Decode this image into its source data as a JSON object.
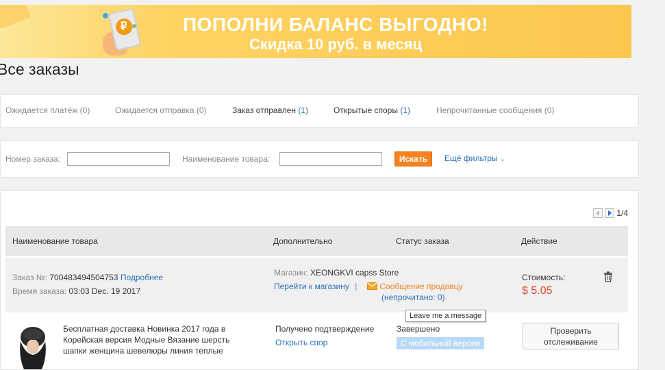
{
  "banner": {
    "line1": "ПОПОЛНИ БАЛАНС ВЫГОДНО!",
    "line2": "Скидка 10 руб. в месяц",
    "coin_symbol": "₽"
  },
  "page_title": "Все заказы",
  "tabs": [
    {
      "label": "Ожидается платёж",
      "count": "(0)"
    },
    {
      "label": "Ожидается отправка",
      "count": "(0)"
    },
    {
      "label": "Заказ отправлен",
      "count": "(1)"
    },
    {
      "label": "Открытые споры",
      "count": "(1)"
    },
    {
      "label": "Непрочитанные сообщения",
      "count": "(0)"
    }
  ],
  "filters": {
    "order_number_label": "Номер заказа:",
    "order_number_value": "",
    "product_name_label": "Наименование товара:",
    "product_name_value": "",
    "search_button": "Искать",
    "more_filters": "Ещё фильтры"
  },
  "pager": {
    "label": "1/4"
  },
  "table": {
    "headers": [
      "Наименование товара",
      "Дополнительно",
      "Статус заказа",
      "Действие"
    ]
  },
  "order": {
    "number_label": "Заказ №:",
    "number_value": "700483494504753",
    "details_link": "Подробнее",
    "time_label": "Время заказа:",
    "time_value": "03:03 Dec. 19 2017",
    "store_label": "Магазин:",
    "store_name": "XEONGKVI capss Store",
    "goto_store": "Перейти к магазину",
    "separator": "|",
    "message_seller": "Сообщение продавцу",
    "unread": "(непрочитано: 0)",
    "cost_label": "Стоимость:",
    "cost_value": "$ 5.05"
  },
  "item": {
    "description": "Бесплатная доставка Новинка 2017 года в Корейская версия Модные Вязание шерсть шапки женщина шевелюры линия теплые",
    "status": "Получено подтверждение",
    "open_dispute": "Открыть спор",
    "order_status": "Завершено",
    "mobile_badge": "С мобильной версии",
    "track_button": "Проверить отслеживание"
  },
  "tooltip": "Leave me a message",
  "colors": {
    "accent_orange": "#f5821f",
    "link_blue": "#2a6fb8",
    "price_red": "#e0452b"
  }
}
